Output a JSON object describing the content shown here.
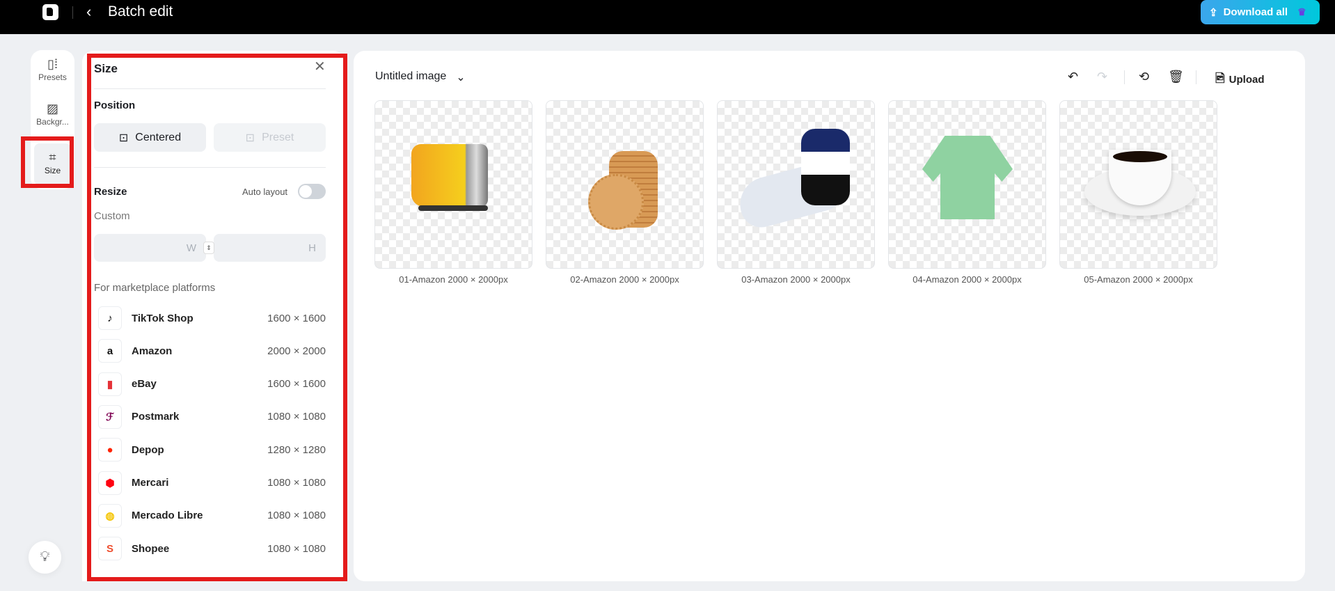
{
  "header": {
    "title": "Batch edit",
    "download_label": "Download all"
  },
  "rail": {
    "items": [
      {
        "label": "Presets"
      },
      {
        "label": "Backgr..."
      },
      {
        "label": "Size"
      }
    ]
  },
  "panel": {
    "title": "Size",
    "position_label": "Position",
    "centered_label": "Centered",
    "preset_label": "Preset",
    "resize_label": "Resize",
    "auto_layout_label": "Auto layout",
    "auto_layout_on": false,
    "custom_label": "Custom",
    "width_placeholder": "W",
    "height_placeholder": "H",
    "marketplace_label": "For marketplace platforms",
    "platforms": [
      {
        "name": "TikTok Shop",
        "size": "1600 × 1600",
        "color": "#000000",
        "glyph": "♪"
      },
      {
        "name": "Amazon",
        "size": "2000 × 2000",
        "color": "#111111",
        "glyph": "a"
      },
      {
        "name": "eBay",
        "size": "1600 × 1600",
        "color": "#e53238",
        "glyph": "▮"
      },
      {
        "name": "Postmark",
        "size": "1080 × 1080",
        "color": "#7f0353",
        "glyph": "ℱ"
      },
      {
        "name": "Depop",
        "size": "1280 × 1280",
        "color": "#ff2300",
        "glyph": "●"
      },
      {
        "name": "Mercari",
        "size": "1080 × 1080",
        "color": "#ff0211",
        "glyph": "⬢"
      },
      {
        "name": "Mercado Libre",
        "size": "1080 × 1080",
        "color": "#f5c400",
        "glyph": "◍"
      },
      {
        "name": "Shopee",
        "size": "1080 × 1080",
        "color": "#ee4d2d",
        "glyph": "S"
      }
    ]
  },
  "main": {
    "doc_title": "Untitled image",
    "upload_label": "Upload",
    "images": [
      {
        "caption": "01-Amazon 2000 × 2000px"
      },
      {
        "caption": "02-Amazon 2000 × 2000px"
      },
      {
        "caption": "03-Amazon 2000 × 2000px"
      },
      {
        "caption": "04-Amazon 2000 × 2000px"
      },
      {
        "caption": "05-Amazon 2000 × 2000px"
      }
    ]
  }
}
